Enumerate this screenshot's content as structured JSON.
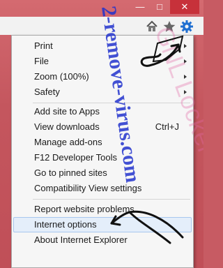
{
  "window": {
    "min_glyph": "—",
    "max_glyph": "□",
    "close_glyph": "✕"
  },
  "toolbar": {
    "icons": [
      "home-icon",
      "star-icon",
      "gear-icon"
    ],
    "gear_color": "#1f6fd1"
  },
  "menu": {
    "print": "Print",
    "file": "File",
    "zoom": "Zoom (100%)",
    "safety": "Safety",
    "add_site": "Add site to Apps",
    "view_downloads": "View downloads",
    "view_downloads_shortcut": "Ctrl+J",
    "manage_addons": "Manage add-ons",
    "dev_tools": "F12 Developer Tools",
    "pinned_sites": "Go to pinned sites",
    "compat_view": "Compatibility View settings",
    "report_problems": "Report website problems",
    "internet_options": "Internet options",
    "about_ie": "About Internet Explorer"
  },
  "watermark": {
    "text": "2-remove-virus.com",
    "color": "#2233cc",
    "ghost_text": "GNL Locker"
  }
}
